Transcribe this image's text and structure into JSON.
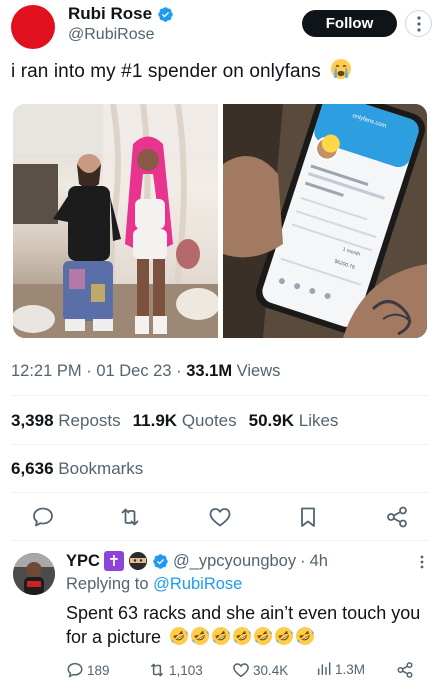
{
  "author": {
    "display_name": "Rubi Rose",
    "handle": "@RubiRose",
    "avatar_color": "#e0101e",
    "verified": true
  },
  "follow_label": "Follow",
  "tweet": {
    "text": "i ran into my #1 spender on onlyfans",
    "emoji": "crying-face",
    "media": [
      {
        "name": "photo-left",
        "description_icon": "photo"
      },
      {
        "name": "photo-right",
        "description_icon": "photo"
      }
    ],
    "phone_screen": {
      "url": "onlyfans.com",
      "stats_label": "1 month",
      "amount": "$6200.78"
    }
  },
  "meta": {
    "time": "12:21 PM",
    "date": "01 Dec 23",
    "views_count": "33.1M",
    "views_label": "Views"
  },
  "stats": {
    "reposts_count": "3,398",
    "reposts_label": "Reposts",
    "quotes_count": "11.9K",
    "quotes_label": "Quotes",
    "likes_count": "50.9K",
    "likes_label": "Likes",
    "bookmarks_count": "6,636",
    "bookmarks_label": "Bookmarks"
  },
  "colors": {
    "text_primary": "#0f1419",
    "text_secondary": "#536471",
    "accent": "#1d9bf0",
    "divider": "#eff3f4"
  },
  "reply": {
    "display_name": "YPC",
    "badge": "✝",
    "handle": "@_ypcyoungboy",
    "separator": "·",
    "time": "4h",
    "replying_prefix": "Replying to",
    "replying_to": "@RubiRose",
    "text": "Spent 63 racks and she ain’t even touch you for a picture",
    "laugh_emoji_count": 7,
    "replies": "189",
    "reposts": "1,103",
    "likes": "30.4K",
    "views": "1.3M"
  }
}
